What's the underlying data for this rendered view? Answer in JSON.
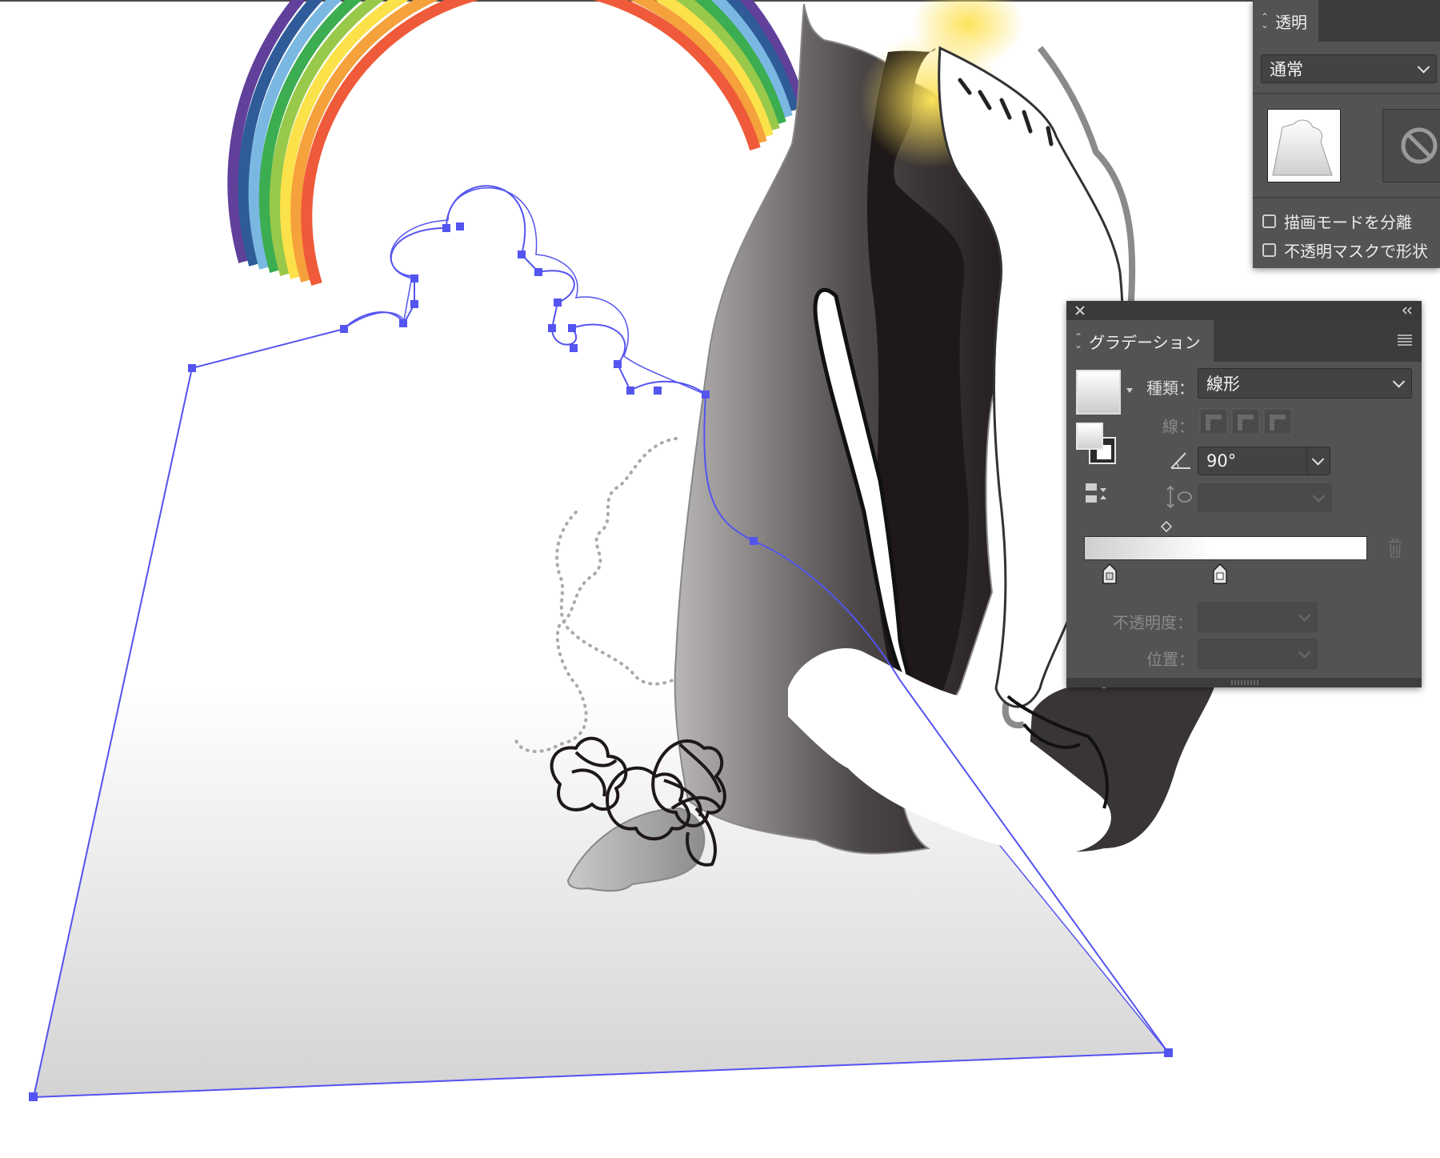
{
  "transparency_panel": {
    "tab_label": "透明",
    "blend_mode": "通常",
    "checkbox_isolate_blending": "描画モードを分離",
    "checkbox_opacity_mask": "不透明マスクで形状"
  },
  "gradient_panel": {
    "tab_label": "グラデーション",
    "type_label": "種類：",
    "type_value": "線形",
    "stroke_label": "線：",
    "angle_value": "90°",
    "opacity_label": "不透明度：",
    "location_label": "位置："
  },
  "icons": {
    "close": "close-icon",
    "collapse": "double-chevron-icon",
    "menu": "hamburger-menu-icon",
    "angle": "angle-icon",
    "aspect": "aspect-ratio-icon",
    "trash": "trash-icon",
    "reverse": "reverse-gradient-icon",
    "none": "no-mask-icon"
  },
  "colors": {
    "panel_bg": "#535353",
    "panel_tab_bar": "#3c3c3c",
    "selection": "#5454f0",
    "rainbow": [
      "#ee5a3a",
      "#fbe24a",
      "#3cad50",
      "#7ab8e2",
      "#2f5c98",
      "#60409a"
    ]
  }
}
